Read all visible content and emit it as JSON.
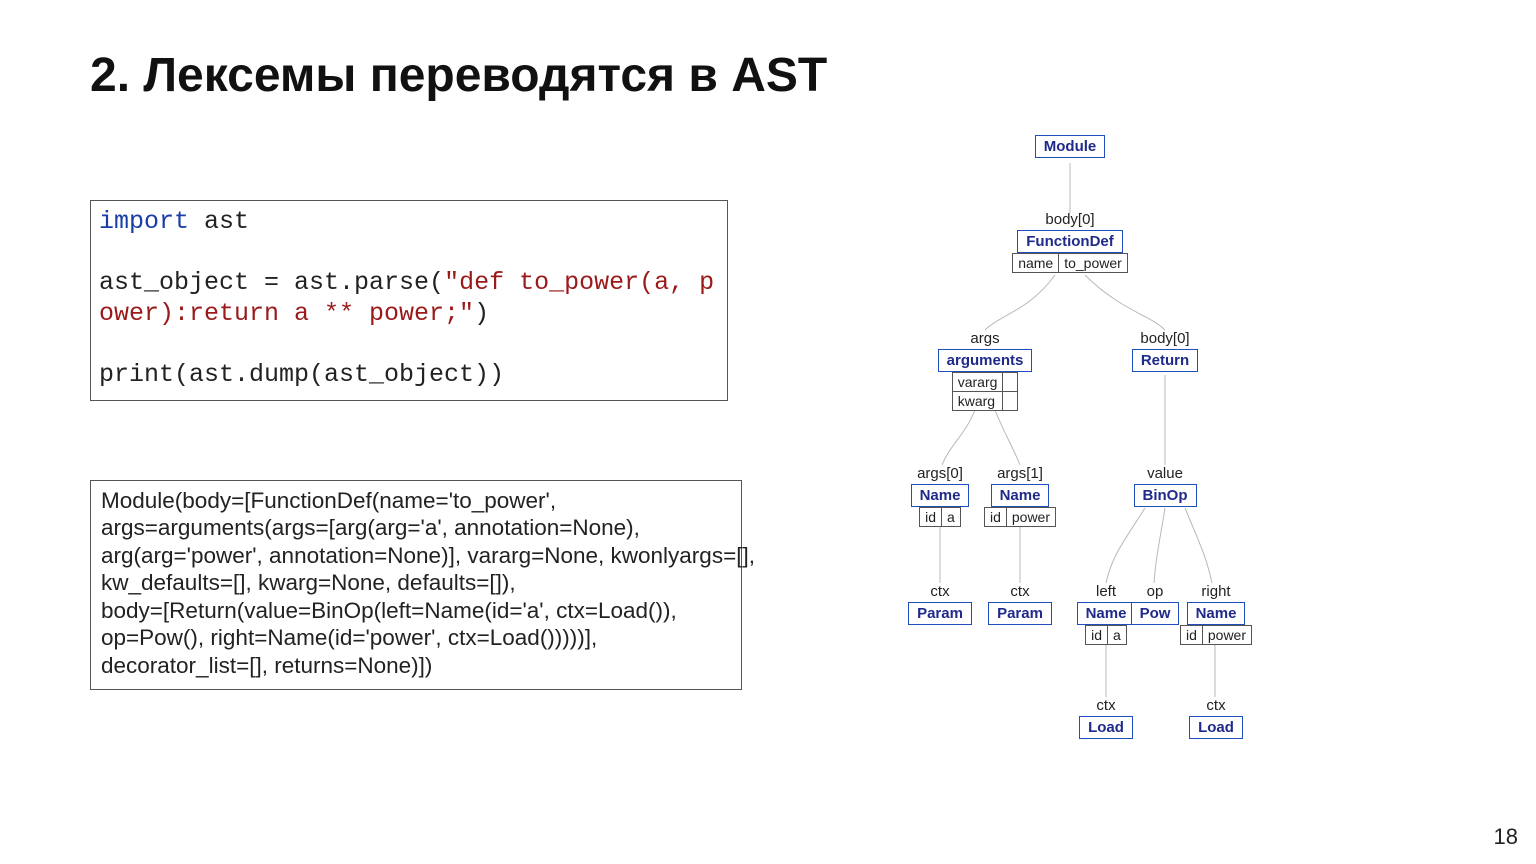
{
  "title": "2. Лексемы переводятся в AST",
  "page_number": "18",
  "code": {
    "import_kw": "import",
    "import_mod": " ast",
    "line2a": "ast_object = ast.parse(",
    "line2s": "\"def to_power(a, p",
    "line3s": "ower):return a ** power;\"",
    "line3b": ")",
    "line5": "print(ast.dump(ast_object))"
  },
  "output": {
    "l1": "Module(body=[FunctionDef(name='to_power',",
    "l2": "args=arguments(args=[arg(arg='a', annotation=None),",
    "l3": "arg(arg='power', annotation=None)], vararg=None, kwonlyargs=[],",
    "l4": "kw_defaults=[], kwarg=None, defaults=[]),",
    "l5": "body=[Return(value=BinOp(left=Name(id='a', ctx=Load()),",
    "l6": "op=Pow(), right=Name(id='power', ctx=Load()))))],",
    "l7": "decorator_list=[], returns=None)])"
  },
  "tree": {
    "module": "Module",
    "functiondef": {
      "edge": "body[0]",
      "label": "FunctionDef",
      "a0k": "name",
      "a0v": "to_power"
    },
    "arguments": {
      "edge": "args",
      "label": "arguments",
      "a0k": "vararg",
      "a0v": "",
      "a1k": "kwarg",
      "a1v": ""
    },
    "return": {
      "edge": "body[0]",
      "label": "Return"
    },
    "name_a": {
      "edge": "args[0]",
      "label": "Name",
      "a0k": "id",
      "a0v": "a"
    },
    "name_power": {
      "edge": "args[1]",
      "label": "Name",
      "a0k": "id",
      "a0v": "power"
    },
    "binop": {
      "edge": "value",
      "label": "BinOp"
    },
    "param1": {
      "edge": "ctx",
      "label": "Param"
    },
    "param2": {
      "edge": "ctx",
      "label": "Param"
    },
    "left_name": {
      "edge": "left",
      "label": "Name",
      "a0k": "id",
      "a0v": "a"
    },
    "pow": {
      "edge": "op",
      "label": "Pow"
    },
    "right_name": {
      "edge": "right",
      "label": "Name",
      "a0k": "id",
      "a0v": "power"
    },
    "load1": {
      "edge": "ctx",
      "label": "Load"
    },
    "load2": {
      "edge": "ctx",
      "label": "Load"
    }
  }
}
